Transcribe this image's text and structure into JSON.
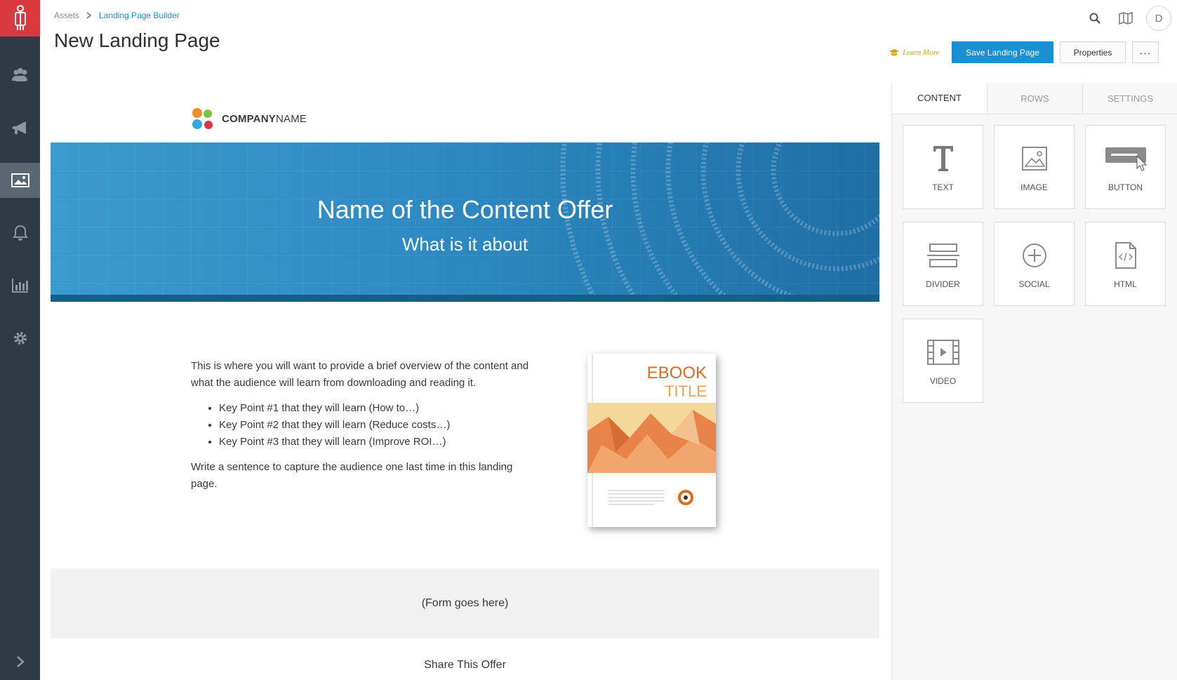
{
  "nav": {
    "items": [
      {
        "name": "contacts",
        "icon": "people-icon"
      },
      {
        "name": "campaigns",
        "icon": "megaphone-icon"
      },
      {
        "name": "assets",
        "icon": "image-icon",
        "active": true
      },
      {
        "name": "notifications",
        "icon": "bell-icon"
      },
      {
        "name": "reports",
        "icon": "bar-chart-icon"
      },
      {
        "name": "settings",
        "icon": "gear-icon"
      }
    ],
    "expand_icon": "chevron-right-icon"
  },
  "header": {
    "breadcrumb": {
      "root": "Assets",
      "current": "Landing Page Builder"
    },
    "title": "New Landing Page",
    "learn_more": "Learn More",
    "save_label": "Save Landing Page",
    "properties_label": "Properties",
    "more_label": "···",
    "avatar_initial": "D"
  },
  "canvas": {
    "company": {
      "bold": "COMPANY",
      "rest": "NAME"
    },
    "hero": {
      "title": "Name of the Content Offer",
      "subtitle": "What is it about"
    },
    "intro": "This is where you will want to provide a brief overview of the content and what the audience will learn from downloading and reading it.",
    "key_points": [
      "Key Point #1 that they will learn (How to…)",
      "Key Point #2 that they will learn (Reduce costs…)",
      "Key Point #3 that they will learn (Improve ROI…)"
    ],
    "closing": "Write a sentence to capture the audience one last time in this landing page.",
    "ebook": {
      "line1": "EBOOK",
      "line2": "TITLE"
    },
    "form_placeholder": "(Form goes here)",
    "share": "Share This Offer"
  },
  "panel": {
    "tabs": [
      "CONTENT",
      "ROWS",
      "SETTINGS"
    ],
    "active_tab": "CONTENT",
    "blocks": [
      "TEXT",
      "IMAGE",
      "BUTTON",
      "DIVIDER",
      "SOCIAL",
      "HTML",
      "VIDEO"
    ]
  },
  "colors": {
    "accent": "#1a8fd1",
    "nav": "#2e3a46",
    "brand": "#d9383e",
    "learn_more": "#e0a000"
  }
}
